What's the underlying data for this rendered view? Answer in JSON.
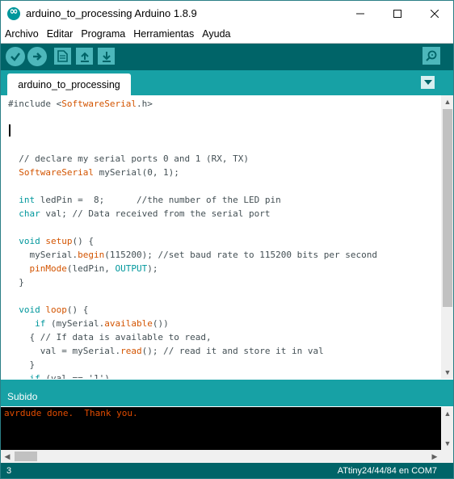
{
  "window": {
    "title": "arduino_to_processing Arduino 1.8.9",
    "controls": [
      "minimize-icon",
      "maximize-icon",
      "close-icon"
    ]
  },
  "menu": {
    "items": [
      "Archivo",
      "Editar",
      "Programa",
      "Herramientas",
      "Ayuda"
    ]
  },
  "toolbar": {
    "buttons": [
      "verify-icon",
      "upload-icon",
      "new-icon",
      "open-icon",
      "save-icon",
      "serial-monitor-icon"
    ]
  },
  "tabs": {
    "active": "arduino_to_processing"
  },
  "editor": {
    "lines": [
      "#include <SoftwareSerial.h>",
      "",
      "",
      "",
      "  // declare my serial ports 0 and 1 (RX, TX)",
      "  SoftwareSerial mySerial(0, 1);",
      "",
      "  int ledPin =  8;      //the number of the LED pin",
      "  char val; // Data received from the serial port",
      "",
      "  void setup() {",
      "    mySerial.begin(115200); //set baud rate to 115200 bits per second",
      "    pinMode(ledPin, OUTPUT);",
      "  }",
      "",
      "  void loop() {",
      "     if (mySerial.available())",
      "    { // If data is available to read,",
      "      val = mySerial.read(); // read it and store it in val",
      "    }",
      "    if (val == '1')"
    ]
  },
  "status": {
    "message": "Subido"
  },
  "console": {
    "lines": [
      "avrdude done.  Thank you."
    ]
  },
  "footer": {
    "line_number": "3",
    "board": "ATtiny24/44/84 en COM7"
  },
  "colors": {
    "toolbar_bg": "#006468",
    "strip_bg": "#17a1a5",
    "button_bg": "#4db7bb",
    "keyword": "#00979c",
    "function": "#d35400",
    "console_text": "#e34c00"
  }
}
